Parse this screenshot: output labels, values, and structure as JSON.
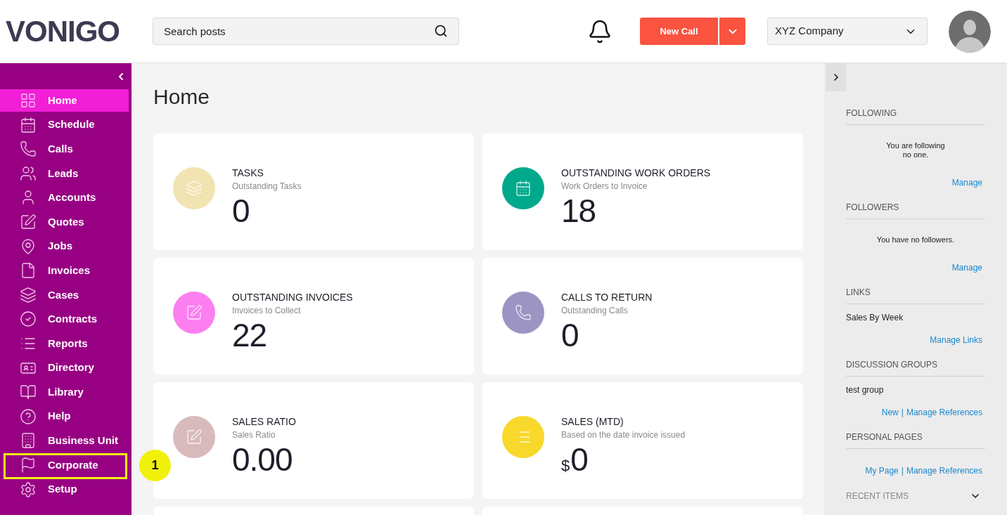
{
  "header": {
    "logo": "VONIGO",
    "search": {
      "placeholder": "Search posts"
    },
    "new_call_button": "New Call",
    "company_select": {
      "value": "XYZ Company"
    }
  },
  "sidebar": {
    "items": [
      {
        "label": "Home",
        "selected": true,
        "highlighted": false
      },
      {
        "label": "Schedule",
        "selected": false,
        "highlighted": false
      },
      {
        "label": "Calls",
        "selected": false,
        "highlighted": false
      },
      {
        "label": "Leads",
        "selected": false,
        "highlighted": false
      },
      {
        "label": "Accounts",
        "selected": false,
        "highlighted": false
      },
      {
        "label": "Quotes",
        "selected": false,
        "highlighted": false
      },
      {
        "label": "Jobs",
        "selected": false,
        "highlighted": false
      },
      {
        "label": "Invoices",
        "selected": false,
        "highlighted": false
      },
      {
        "label": "Cases",
        "selected": false,
        "highlighted": false
      },
      {
        "label": "Contracts",
        "selected": false,
        "highlighted": false
      },
      {
        "label": "Reports",
        "selected": false,
        "highlighted": false
      },
      {
        "label": "Directory",
        "selected": false,
        "highlighted": false
      },
      {
        "label": "Library",
        "selected": false,
        "highlighted": false
      },
      {
        "label": "Help",
        "selected": false,
        "highlighted": false
      },
      {
        "label": "Business Unit",
        "selected": false,
        "highlighted": false
      },
      {
        "label": "Corporate",
        "selected": false,
        "highlighted": true
      },
      {
        "label": "Setup",
        "selected": false,
        "highlighted": false
      }
    ]
  },
  "main": {
    "title": "Home",
    "cards": [
      {
        "kind": "stat",
        "title": "TASKS",
        "subtitle": "Outstanding Tasks",
        "value": "0",
        "color": "#f2e3b3"
      },
      {
        "kind": "stat",
        "title": "OUTSTANDING WORK ORDERS",
        "subtitle": "Work Orders to Invoice",
        "value": "18",
        "color": "#00a98b"
      },
      {
        "kind": "stat",
        "title": "OUTSTANDING INVOICES",
        "subtitle": "Invoices to Collect",
        "value": "22",
        "color": "#fc7ff0"
      },
      {
        "kind": "stat",
        "title": "CALLS TO RETURN",
        "subtitle": "Outstanding Calls",
        "value": "0",
        "color": "#9c95c3"
      },
      {
        "kind": "stat",
        "title": "SALES RATIO",
        "subtitle": "Sales Ratio",
        "value": "0.00",
        "color": "#d9babb"
      },
      {
        "kind": "stat",
        "title": "SALES (MTD)",
        "subtitle": "Based on the date invoice issued",
        "prefix": "$",
        "value": "0",
        "color": "#f8d82b"
      },
      {
        "kind": "blank"
      },
      {
        "kind": "blank"
      }
    ]
  },
  "right_panel": {
    "sections": [
      {
        "kind": "list",
        "heading": "FOLLOWING",
        "message": "You are following\nno one.",
        "links": [
          {
            "label": "Manage"
          }
        ]
      },
      {
        "kind": "list",
        "heading": "FOLLOWERS",
        "message": "You have no followers.",
        "links": [
          {
            "label": "Manage"
          }
        ]
      },
      {
        "kind": "list",
        "heading": "LINKS",
        "items": [
          "Sales By Week"
        ],
        "links": [
          {
            "label": "Manage Links"
          }
        ]
      },
      {
        "kind": "list",
        "heading": "DISCUSSION GROUPS",
        "items": [
          "test group"
        ],
        "links": [
          {
            "label": "New"
          },
          {
            "label": "Manage References"
          }
        ],
        "separator": "|"
      },
      {
        "kind": "list",
        "heading": "PERSONAL PAGES",
        "links": [
          {
            "label": "My Page"
          },
          {
            "label": "Manage References"
          }
        ],
        "separator": "|"
      },
      {
        "kind": "collapsible",
        "heading": "RECENT ITEMS"
      }
    ]
  },
  "callout": {
    "label": "1"
  }
}
